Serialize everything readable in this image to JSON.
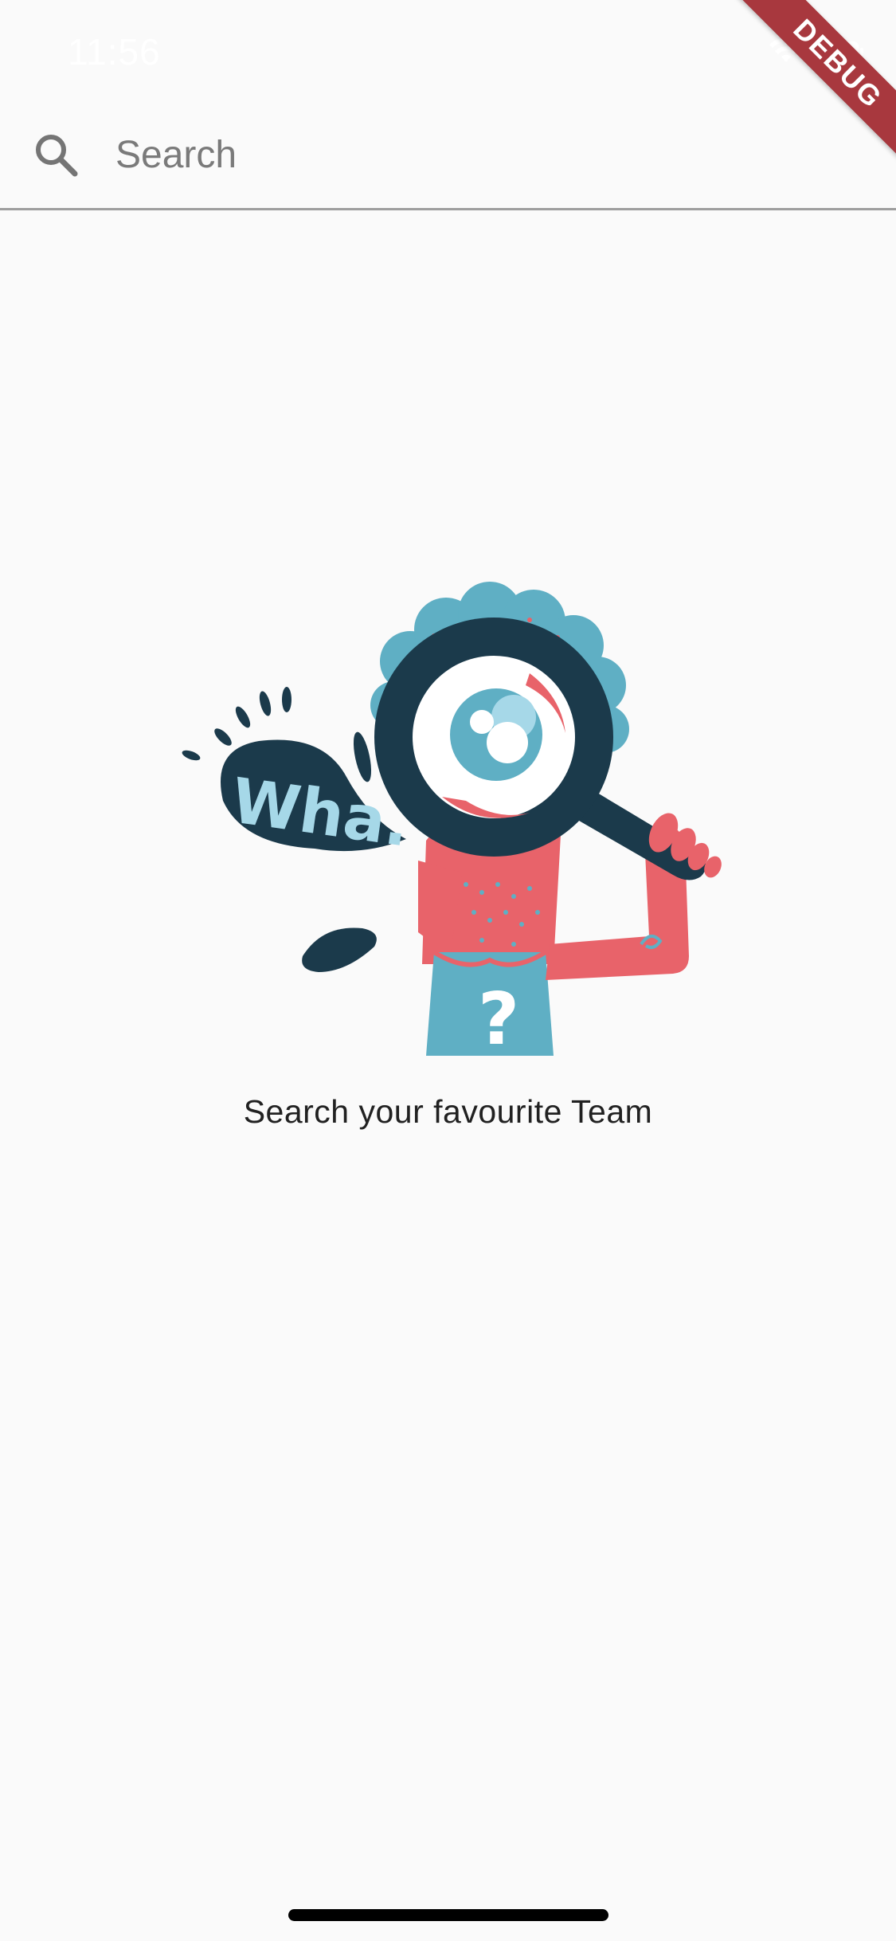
{
  "status_bar": {
    "time": "11:56"
  },
  "debug_banner": {
    "label": "DEBUG"
  },
  "search": {
    "placeholder": "Search",
    "value": "",
    "icon": "search-icon"
  },
  "illustration": {
    "bubble_text": "Wha.",
    "shirt_text": "?"
  },
  "empty_state": {
    "message": "Search your favourite Team"
  },
  "colors": {
    "background": "#fafafa",
    "navy": "#1b3a4b",
    "teal": "#5fafc4",
    "light_blue": "#a6d8e8",
    "coral": "#e8636a",
    "debug_red": "#a8383e"
  }
}
